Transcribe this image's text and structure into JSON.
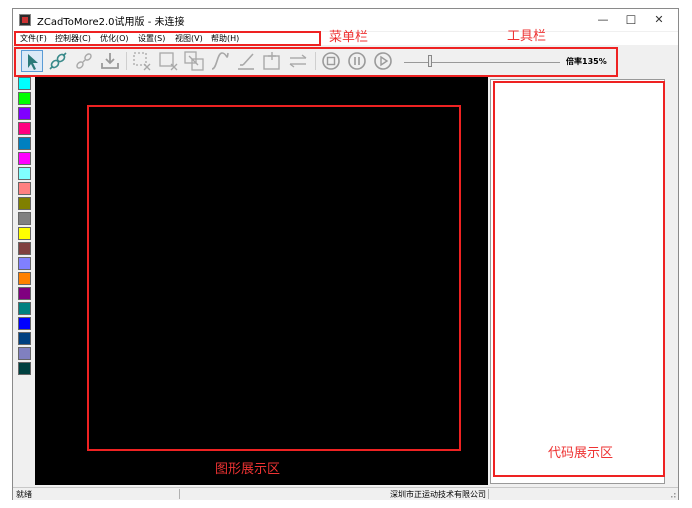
{
  "window": {
    "title": "ZCadToMore2.0试用版 - 未连接",
    "minimize_glyph": "—",
    "maximize_glyph": "☐",
    "close_glyph": "✕"
  },
  "menu": [
    {
      "label": "文件(F)"
    },
    {
      "label": "控制器(C)"
    },
    {
      "label": "优化(O)"
    },
    {
      "label": "设置(S)"
    },
    {
      "label": "视图(V)"
    },
    {
      "label": "帮助(H)"
    }
  ],
  "toolbar": {
    "icons": [
      "select-arrow-icon",
      "connect-icon",
      "disconnect-icon",
      "download-icon",
      "delete-selection-icon",
      "delete-box-icon",
      "select-region-icon",
      "curve-icon",
      "pen-edit-icon",
      "add-point-icon",
      "reverse-icon",
      "stop-icon",
      "pause-icon",
      "play-icon"
    ],
    "zoom_label": "倍率135%"
  },
  "palette": {
    "colors": [
      "#00ffff",
      "#00ff00",
      "#8000ff",
      "#ff0080",
      "#0080c0",
      "#ff00ff",
      "#80ffff",
      "#ff8080",
      "#808000",
      "#808080",
      "#ffff00",
      "#804040",
      "#8080ff",
      "#ff8000",
      "#800080",
      "#008080",
      "#0000ff",
      "#004080",
      "#8080c0",
      "#004040"
    ]
  },
  "status": {
    "left": "就绪",
    "company": "深圳市正运动技术有限公司"
  },
  "annotations": {
    "menubar": "菜单栏",
    "toolbar": "工具栏",
    "graphics": "图形展示区",
    "code": "代码展示区",
    "color": "#ee3333"
  }
}
